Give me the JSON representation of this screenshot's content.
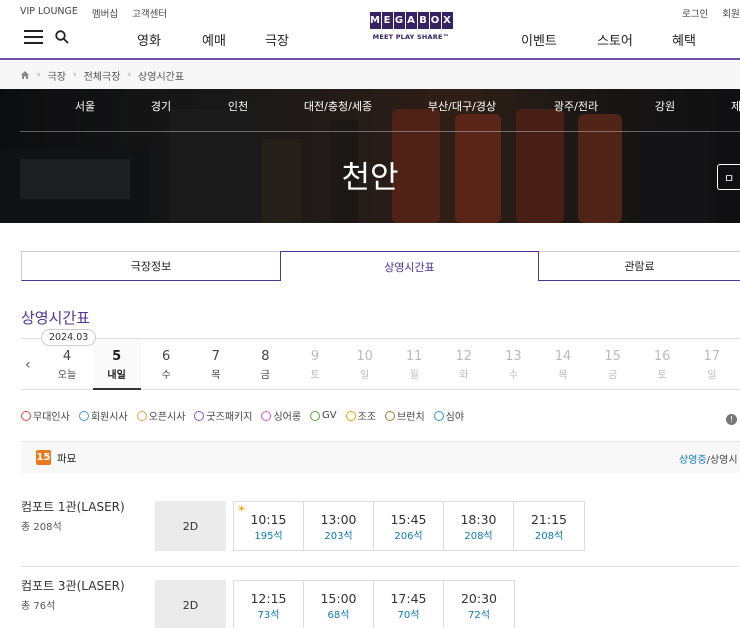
{
  "util": {
    "left_links": [
      "VIP LOUNGE",
      "멤버십",
      "고객센터"
    ],
    "right_links": [
      "로그인",
      "회원가입"
    ]
  },
  "logo": {
    "letters": [
      "M",
      "E",
      "G",
      "A",
      "B",
      "O",
      "X"
    ],
    "tagline": "MEET PLAY SHARE™"
  },
  "gnb": {
    "items": [
      "영화",
      "예매",
      "극장",
      "이벤트",
      "스토어",
      "혜택"
    ]
  },
  "breadcrumb": {
    "items": [
      "극장",
      "전체극장",
      "상영시간표"
    ]
  },
  "hero": {
    "regions": [
      "서울",
      "경기",
      "인천",
      "대전/충청/세종",
      "부산/대구/경상",
      "광주/전라",
      "강원",
      "제"
    ],
    "title": "천안",
    "button_label": "ㅁ"
  },
  "tabs": [
    "극장정보",
    "상영시간표",
    "관람료"
  ],
  "section_title": "상영시간표",
  "dates": {
    "month_badge": "2024.03",
    "items": [
      {
        "num": "4",
        "day": "오늘",
        "state": "normal"
      },
      {
        "num": "5",
        "day": "내일",
        "state": "active"
      },
      {
        "num": "6",
        "day": "수",
        "state": "normal"
      },
      {
        "num": "7",
        "day": "목",
        "state": "normal"
      },
      {
        "num": "8",
        "day": "금",
        "state": "normal"
      },
      {
        "num": "9",
        "day": "토",
        "state": "disabled"
      },
      {
        "num": "10",
        "day": "일",
        "state": "disabled"
      },
      {
        "num": "11",
        "day": "월",
        "state": "disabled"
      },
      {
        "num": "12",
        "day": "화",
        "state": "disabled"
      },
      {
        "num": "13",
        "day": "수",
        "state": "disabled"
      },
      {
        "num": "14",
        "day": "목",
        "state": "disabled"
      },
      {
        "num": "15",
        "day": "금",
        "state": "disabled"
      },
      {
        "num": "16",
        "day": "토",
        "state": "disabled"
      },
      {
        "num": "17",
        "day": "일",
        "state": "disabled"
      }
    ]
  },
  "legend": [
    {
      "label": "무대인사",
      "color": "#e0474c"
    },
    {
      "label": "회원시사",
      "color": "#3ea0d9"
    },
    {
      "label": "오픈시사",
      "color": "#e9a33a"
    },
    {
      "label": "굿즈패키지",
      "color": "#8b4fc9"
    },
    {
      "label": "싱어롱",
      "color": "#d65cc7"
    },
    {
      "label": "GV",
      "color": "#5aa23c"
    },
    {
      "label": "조조",
      "color": "#f0a000"
    },
    {
      "label": "브런치",
      "color": "#b07a3a"
    },
    {
      "label": "심야",
      "color": "#2c8fd6"
    }
  ],
  "movie": {
    "age": "15",
    "title": "파묘",
    "status_on": "상영중",
    "status_rest": "/상영시"
  },
  "screenings": [
    {
      "name": "컴포트 1관(LASER)",
      "seats": "총 208석",
      "format": "2D",
      "times": [
        {
          "time": "10:15",
          "seats": "195석",
          "morning": true
        },
        {
          "time": "13:00",
          "seats": "203석",
          "morning": false
        },
        {
          "time": "15:45",
          "seats": "206석",
          "morning": false
        },
        {
          "time": "18:30",
          "seats": "208석",
          "morning": false
        },
        {
          "time": "21:15",
          "seats": "208석",
          "morning": false
        }
      ]
    },
    {
      "name": "컴포트 3관(LASER)",
      "seats": "총 76석",
      "format": "2D",
      "times": [
        {
          "time": "12:15",
          "seats": "73석",
          "morning": false
        },
        {
          "time": "15:00",
          "seats": "68석",
          "morning": false
        },
        {
          "time": "17:45",
          "seats": "70석",
          "morning": false
        },
        {
          "time": "20:30",
          "seats": "72석",
          "morning": false
        }
      ]
    }
  ]
}
